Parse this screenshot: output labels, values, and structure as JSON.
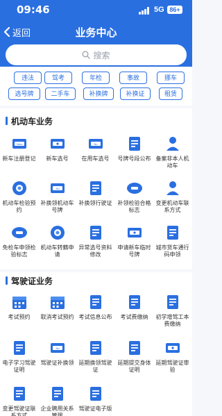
{
  "status": {
    "time": "09:46",
    "network": "5G",
    "battery": "86+"
  },
  "nav": {
    "back": "返回",
    "title": "业务中心"
  },
  "search": {
    "placeholder": "搜索"
  },
  "tags": [
    "违法",
    "驾考",
    "年检",
    "事故",
    "挪车",
    "选号牌",
    "二手车",
    "补换牌",
    "补换证",
    "租赁"
  ],
  "motor": {
    "title": "机动车业务",
    "items": [
      {
        "label": "新车注册登记",
        "icon": "new-car-plate-icon"
      },
      {
        "label": "新车选号",
        "icon": "new-plate-selection-icon"
      },
      {
        "label": "在用车选号",
        "icon": "plate-no-icon"
      },
      {
        "label": "号牌号段公布",
        "icon": "plate-announcement-icon"
      },
      {
        "label": "备案非本人机动车",
        "icon": "person-car-icon"
      },
      {
        "label": "机动车检验预约",
        "icon": "car-inspection-icon"
      },
      {
        "label": "补换领机动车号牌",
        "icon": "plate-exchange-icon"
      },
      {
        "label": "补换领行驶证",
        "icon": "license-exchange-icon"
      },
      {
        "label": "补领检验合格标志",
        "icon": "inspection-badge-icon"
      },
      {
        "label": "变更机动车联系方式",
        "icon": "contact-change-icon"
      },
      {
        "label": "免检车申领检验标志",
        "icon": "exempt-inspection-icon"
      },
      {
        "label": "机动车转籍申请",
        "icon": "car-transfer-icon"
      },
      {
        "label": "异常选号资料修改",
        "icon": "edit-document-icon"
      },
      {
        "label": "申请新车临时号牌",
        "icon": "temp-plate-icon"
      },
      {
        "label": "城市货车通行码申领",
        "icon": "truck-pass-icon"
      }
    ]
  },
  "driver": {
    "title": "驾驶证业务",
    "items": [
      {
        "label": "考试预约",
        "icon": "calendar-icon"
      },
      {
        "label": "取消考试预约",
        "icon": "calendar-cancel-icon"
      },
      {
        "label": "考试信息公布",
        "icon": "exam-info-icon"
      },
      {
        "label": "考试费缴纳",
        "icon": "exam-fee-icon"
      },
      {
        "label": "初学增驾工本费缴纳",
        "icon": "yuan-fee-icon"
      },
      {
        "label": "电子学习驾驶证明",
        "icon": "e-study-icon"
      },
      {
        "label": "驾驶证补换领",
        "icon": "license-replace-icon"
      },
      {
        "label": "延期换领驾驶证",
        "icon": "extend-replace-icon"
      },
      {
        "label": "延期提交身体证明",
        "icon": "health-cert-icon"
      },
      {
        "label": "延期驾驶证审验",
        "icon": "license-review-icon"
      },
      {
        "label": "变更驾驶证联系方式",
        "icon": "license-contact-icon"
      },
      {
        "label": "企业聘用关系管理",
        "icon": "enterprise-icon"
      },
      {
        "label": "驾驶证电子版",
        "icon": "e-license-icon"
      }
    ]
  },
  "colors": {
    "brand": "#2a6fe0",
    "light": "#4c8ff0"
  }
}
